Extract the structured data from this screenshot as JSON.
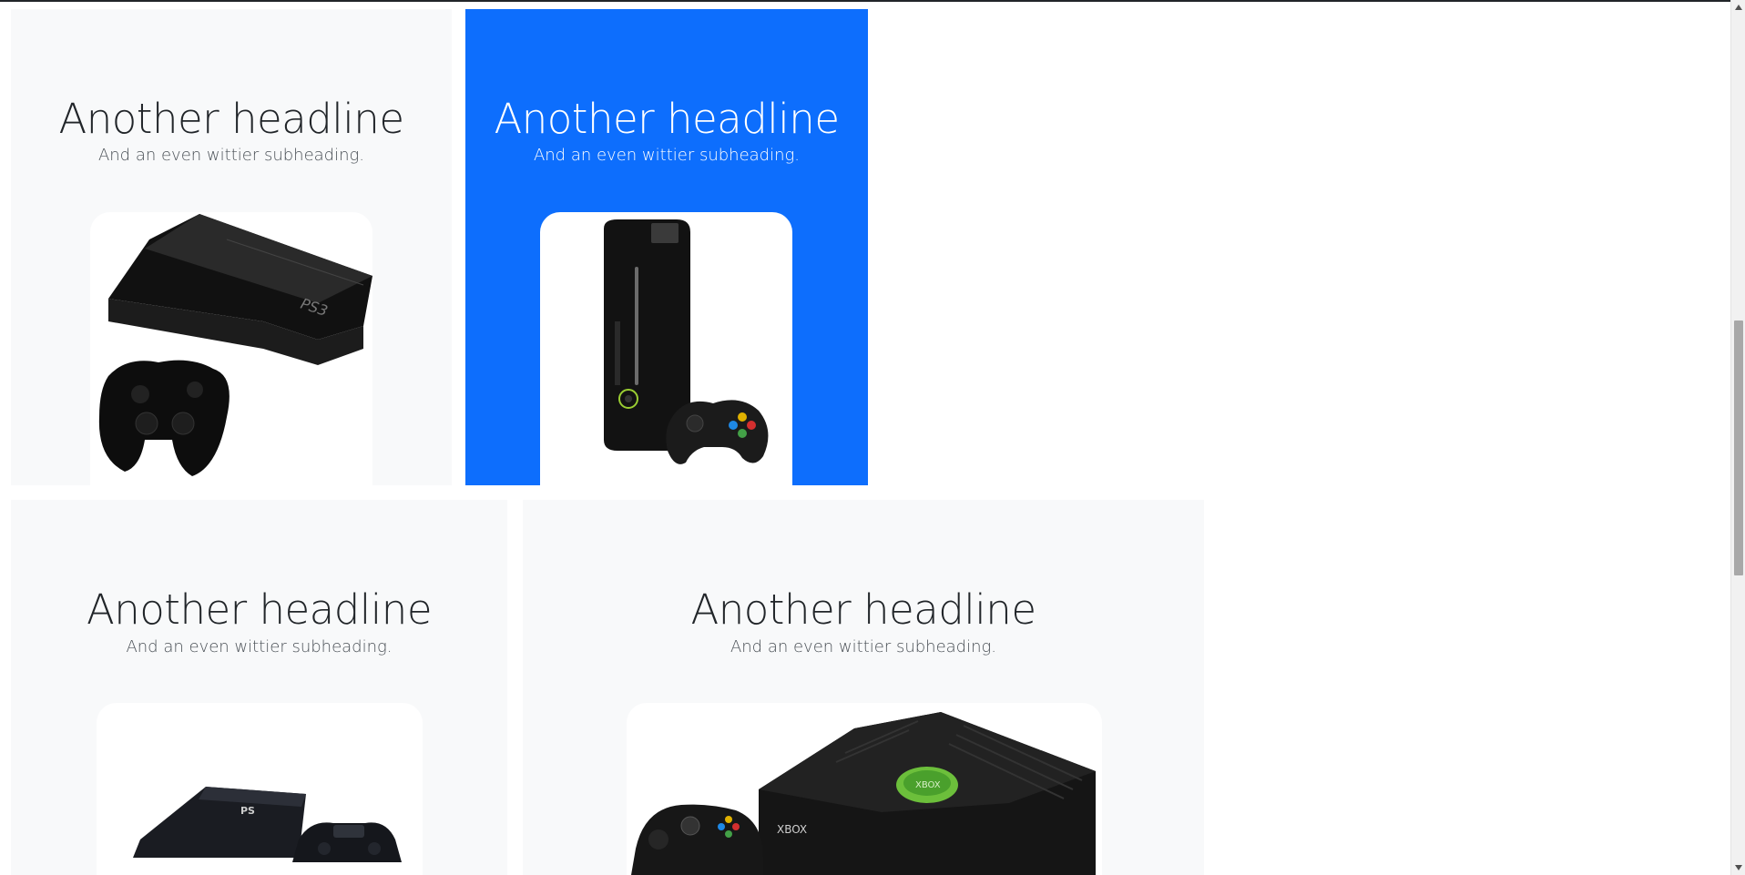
{
  "features": [
    {
      "theme": "light",
      "headline": "Another headline",
      "subheading": "And an even wittier subheading.",
      "image": "playstation-3-console"
    },
    {
      "theme": "primary",
      "headline": "Another headline",
      "subheading": "And an even wittier subheading.",
      "image": "xbox-360-elite-console"
    },
    {
      "theme": "light",
      "headline": "Another headline",
      "subheading": "And an even wittier subheading.",
      "image": "playstation-4-console"
    },
    {
      "theme": "light",
      "headline": "Another headline",
      "subheading": "And an even wittier subheading.",
      "image": "original-xbox-console",
      "logo_text": "XBOX"
    }
  ],
  "scrollbar": {
    "up_icon": "triangle-up-icon",
    "down_icon": "triangle-down-icon"
  }
}
